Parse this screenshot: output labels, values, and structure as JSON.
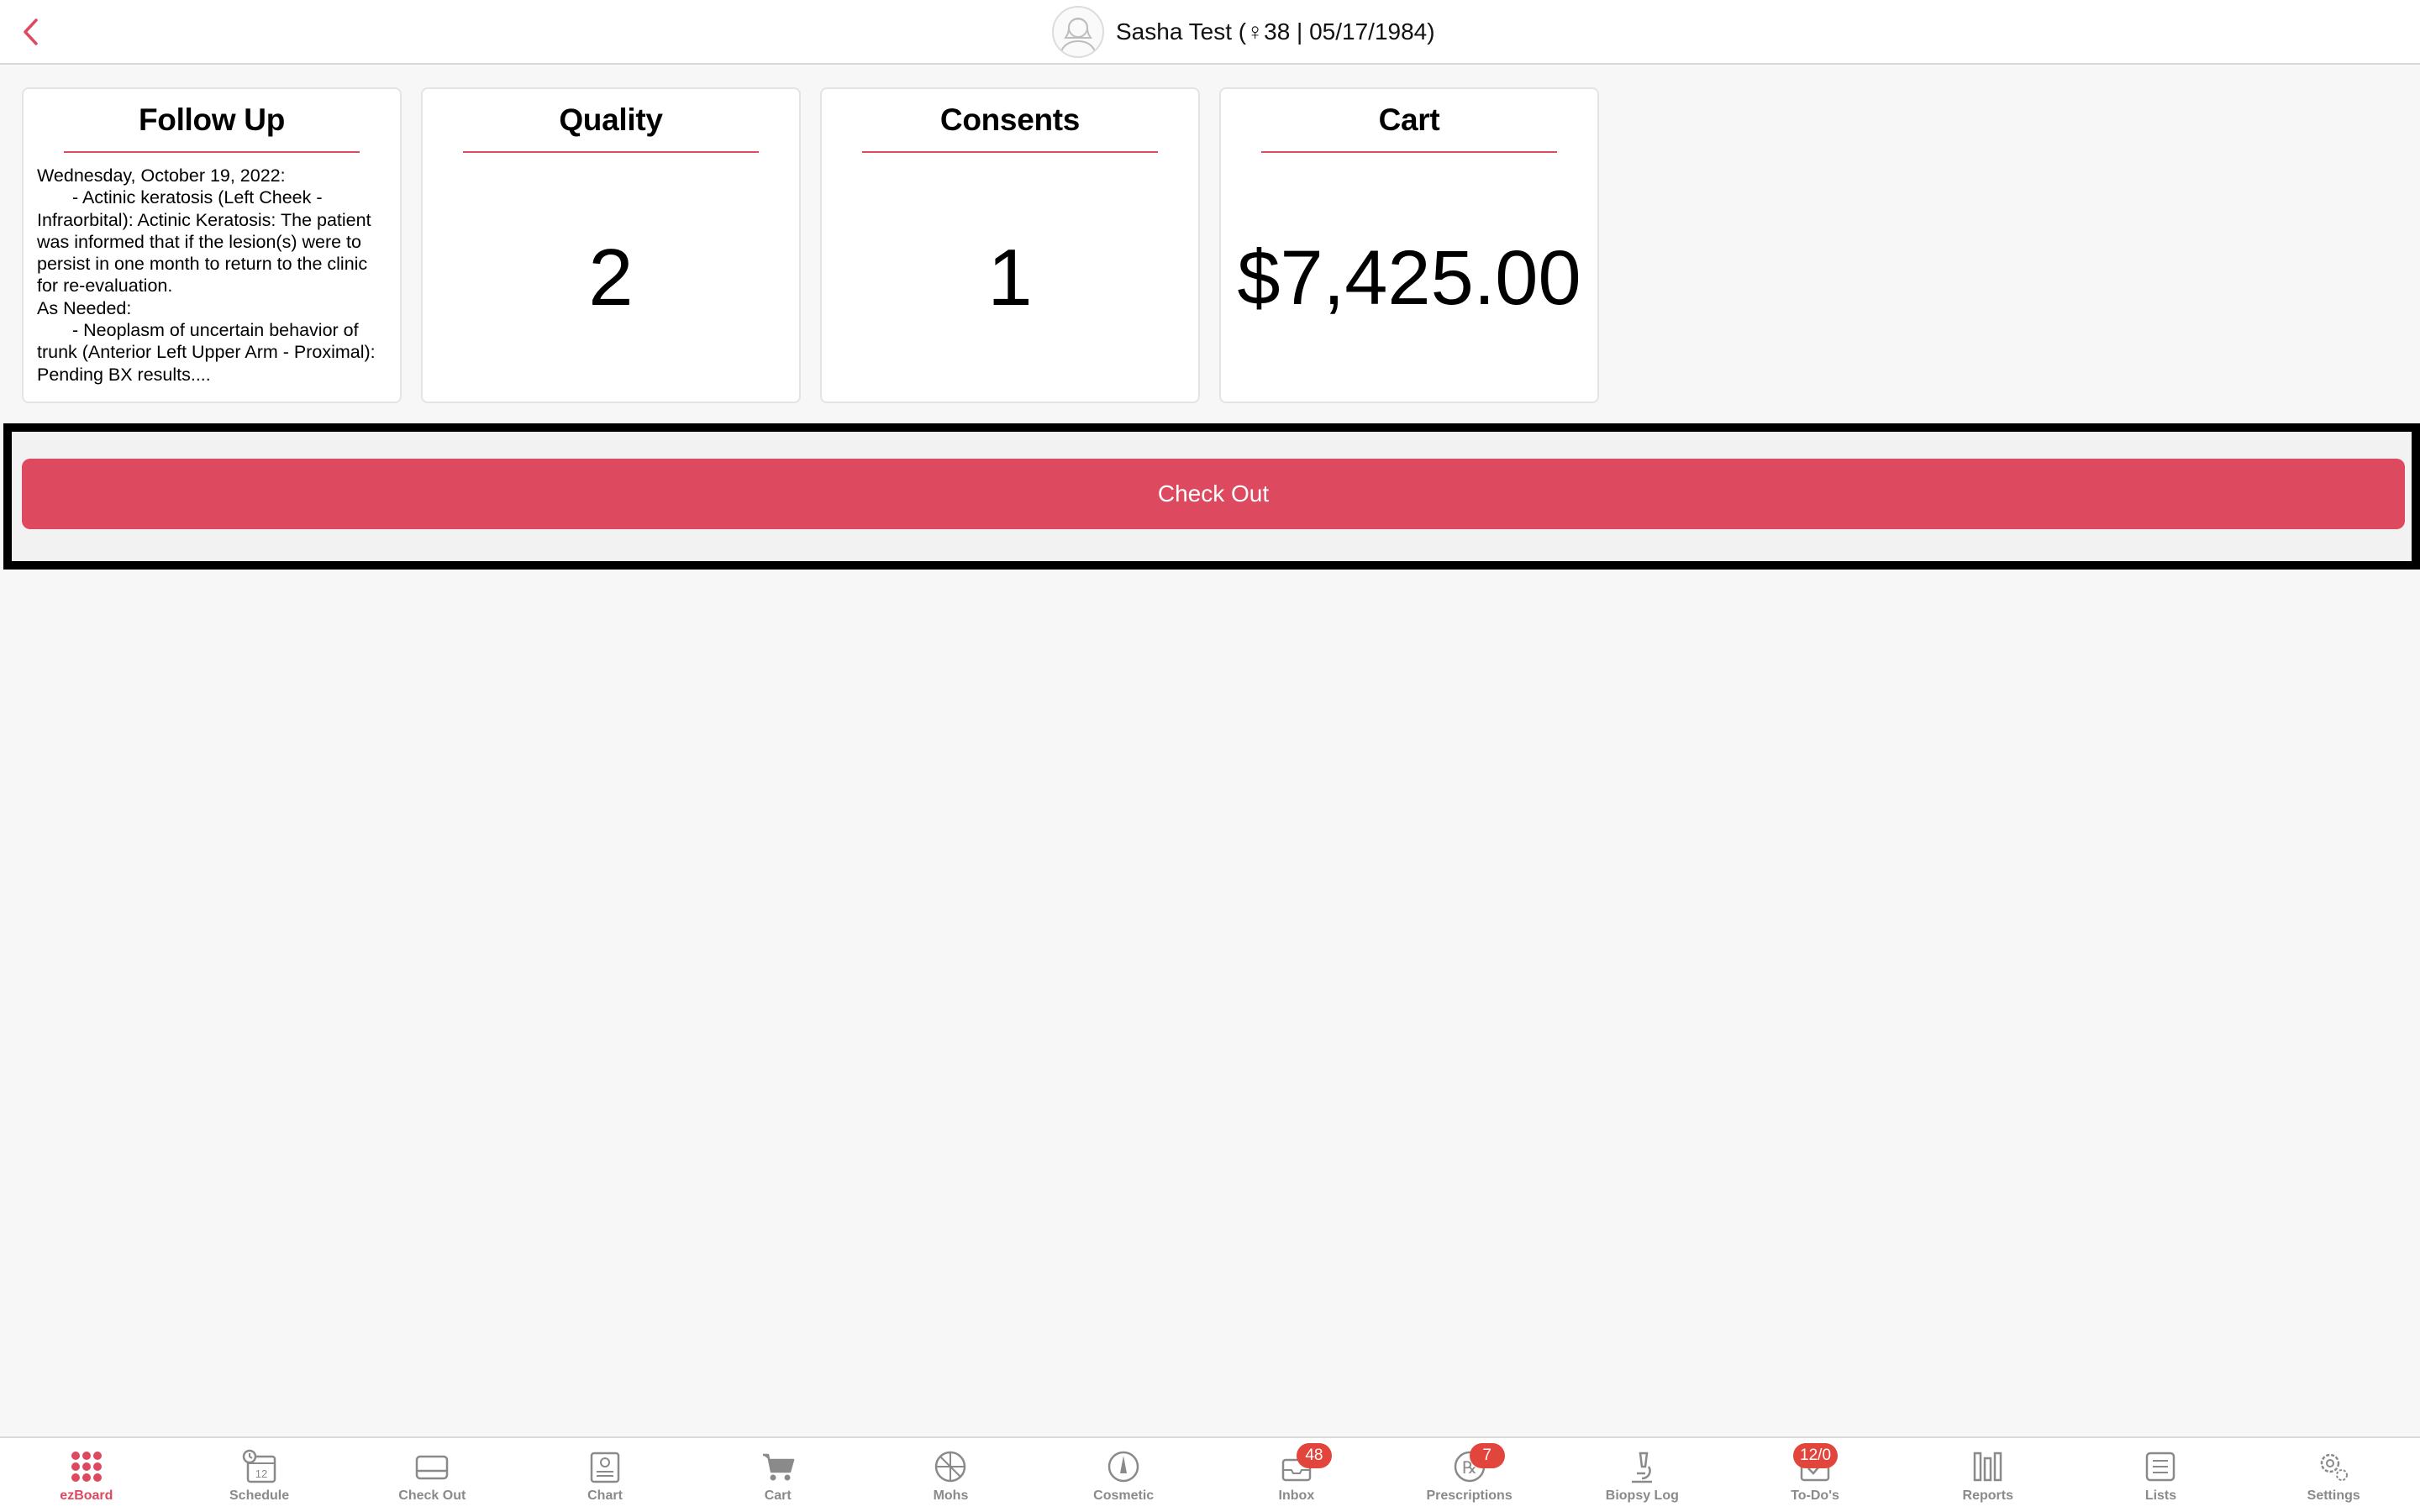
{
  "header": {
    "patient_info": "Sasha Test (♀38 | 05/17/1984)"
  },
  "cards": {
    "followup": {
      "title": "Follow Up",
      "lines": [
        "Wednesday, October 19, 2022:",
        "- Actinic keratosis (Left Cheek - Infraorbital): Actinic Keratosis: The patient was informed that if the lesion(s) were to persist in one month to return to the clinic for re-evaluation.",
        "As Needed:",
        "- Neoplasm of uncertain behavior of trunk (Anterior Left Upper Arm - Proximal): Pending BX results...."
      ]
    },
    "quality": {
      "title": "Quality",
      "value": "2"
    },
    "consents": {
      "title": "Consents",
      "value": "1"
    },
    "cart": {
      "title": "Cart",
      "value": "$7,425.00"
    }
  },
  "checkout": {
    "label": "Check Out"
  },
  "tabbar": {
    "tabs": [
      {
        "label": "ezBoard",
        "icon": "grid-dots-icon",
        "active": true
      },
      {
        "label": "Schedule",
        "icon": "calendar-clock-icon",
        "day": "12"
      },
      {
        "label": "Check Out",
        "icon": "card-icon"
      },
      {
        "label": "Chart",
        "icon": "chart-icon"
      },
      {
        "label": "Cart",
        "icon": "cart-icon"
      },
      {
        "label": "Mohs",
        "icon": "mohs-icon"
      },
      {
        "label": "Cosmetic",
        "icon": "cosmetic-icon"
      },
      {
        "label": "Inbox",
        "icon": "inbox-icon",
        "badge": "48"
      },
      {
        "label": "Prescriptions",
        "icon": "rx-icon",
        "badge": "7"
      },
      {
        "label": "Biopsy Log",
        "icon": "microscope-icon"
      },
      {
        "label": "To-Do's",
        "icon": "todo-icon",
        "badge": "12/0"
      },
      {
        "label": "Reports",
        "icon": "reports-icon"
      },
      {
        "label": "Lists",
        "icon": "list-icon"
      },
      {
        "label": "Settings",
        "icon": "settings-icon"
      }
    ]
  },
  "colors": {
    "accent": "#dd4a5f",
    "badge": "#e2453c",
    "tab_inactive": "#8a8a8a"
  }
}
